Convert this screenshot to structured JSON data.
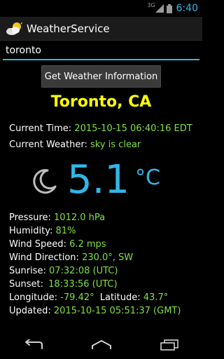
{
  "status_bar": {
    "network": "3G",
    "time": "6:40"
  },
  "app": {
    "title": "WeatherService"
  },
  "search": {
    "value": "toronto"
  },
  "button": {
    "label": "Get Weather Information"
  },
  "city": "Toronto, CA",
  "current_time": {
    "label": "Current Time:",
    "value": "2015-10-15 06:40:16 EDT"
  },
  "current_weather": {
    "label": "Current Weather:",
    "value": "sky is clear"
  },
  "temperature": {
    "value": "5.1",
    "unit": "°C",
    "icon": "moon-icon"
  },
  "details": {
    "pressure": {
      "label": "Pressure:",
      "value": "1012.0 hPa"
    },
    "humidity": {
      "label": "Humidity:",
      "value": "81%"
    },
    "wind_speed": {
      "label": "Wind Speed:",
      "value": "6.2 mps"
    },
    "wind_direction": {
      "label": "Wind Direction:",
      "value": "230.0°, SW"
    },
    "sunrise": {
      "label": "Sunrise:",
      "value": "07:32:08 (UTC)"
    },
    "sunset": {
      "label": "Sunset:",
      "value": "18:33:56 (UTC)"
    },
    "longitude": {
      "label": "Longitude:",
      "value": "-79.42°"
    },
    "latitude": {
      "label": "Latitude:",
      "value": "43.7°"
    },
    "updated": {
      "label": "Updated:",
      "value": "2015-10-15 05:51:37 (GMT)"
    }
  },
  "colors": {
    "accent": "#33b5e5",
    "value_green": "#80e040",
    "city_yellow": "#ffff00"
  }
}
